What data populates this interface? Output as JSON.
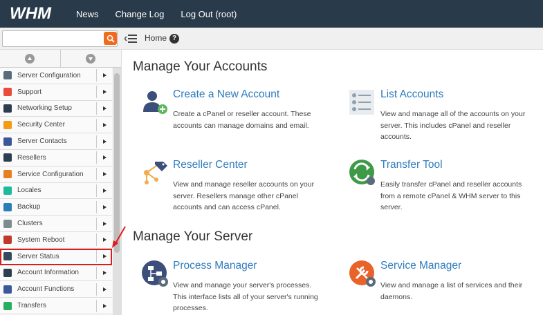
{
  "topbar": {
    "logo_text": "WHM",
    "nav": [
      "News",
      "Change Log",
      "Log Out (root)"
    ]
  },
  "search": {
    "value": "",
    "placeholder": ""
  },
  "breadcrumb": {
    "home": "Home",
    "help": "?"
  },
  "sidebar": {
    "items": [
      {
        "label": "Server Configuration",
        "icon": "server-config-icon",
        "color": "#5a6b7b"
      },
      {
        "label": "Support",
        "icon": "lifebuoy-icon",
        "color": "#e74c3c"
      },
      {
        "label": "Networking Setup",
        "icon": "network-icon",
        "color": "#2c3e50"
      },
      {
        "label": "Security Center",
        "icon": "lock-icon",
        "color": "#f39c12"
      },
      {
        "label": "Server Contacts",
        "icon": "contacts-icon",
        "color": "#3b5998"
      },
      {
        "label": "Resellers",
        "icon": "resellers-icon",
        "color": "#2c3e50"
      },
      {
        "label": "Service Configuration",
        "icon": "wrench-icon",
        "color": "#e67e22"
      },
      {
        "label": "Locales",
        "icon": "chat-icon",
        "color": "#1abc9c"
      },
      {
        "label": "Backup",
        "icon": "backup-icon",
        "color": "#2980b9"
      },
      {
        "label": "Clusters",
        "icon": "clusters-icon",
        "color": "#7f8c8d"
      },
      {
        "label": "System Reboot",
        "icon": "power-icon",
        "color": "#c0392b"
      },
      {
        "label": "Server Status",
        "icon": "monitor-icon",
        "color": "#34495e"
      },
      {
        "label": "Account Information",
        "icon": "id-card-icon",
        "color": "#2c3e50"
      },
      {
        "label": "Account Functions",
        "icon": "user-icon",
        "color": "#3b5998"
      },
      {
        "label": "Transfers",
        "icon": "transfer-icon",
        "color": "#27ae60"
      }
    ]
  },
  "main": {
    "sections": [
      {
        "title": "Manage Your Accounts"
      },
      {
        "title": "Manage Your Server"
      }
    ],
    "cards": [
      {
        "title": "Create a New Account",
        "desc": "Create a cPanel or reseller account. These accounts can manage domains and email."
      },
      {
        "title": "List Accounts",
        "desc": "View and manage all of the accounts on your server. This includes cPanel and reseller accounts."
      },
      {
        "title": "Reseller Center",
        "desc": "View and manage reseller accounts on your server. Resellers manage other cPanel accounts and can access cPanel."
      },
      {
        "title": "Transfer Tool",
        "desc": "Easily transfer cPanel and reseller accounts from a remote cPanel & WHM server to this server."
      },
      {
        "title": "Process Manager",
        "desc": "View and manage your server's processes. This interface lists all of your server's running processes."
      },
      {
        "title": "Service Manager",
        "desc": "View and manage a list of services and their daemons."
      }
    ]
  },
  "colors": {
    "topbar": "#293a4a",
    "link": "#2e7bbd",
    "highlight": "#e01b1b",
    "search_button": "#f26b1d"
  }
}
